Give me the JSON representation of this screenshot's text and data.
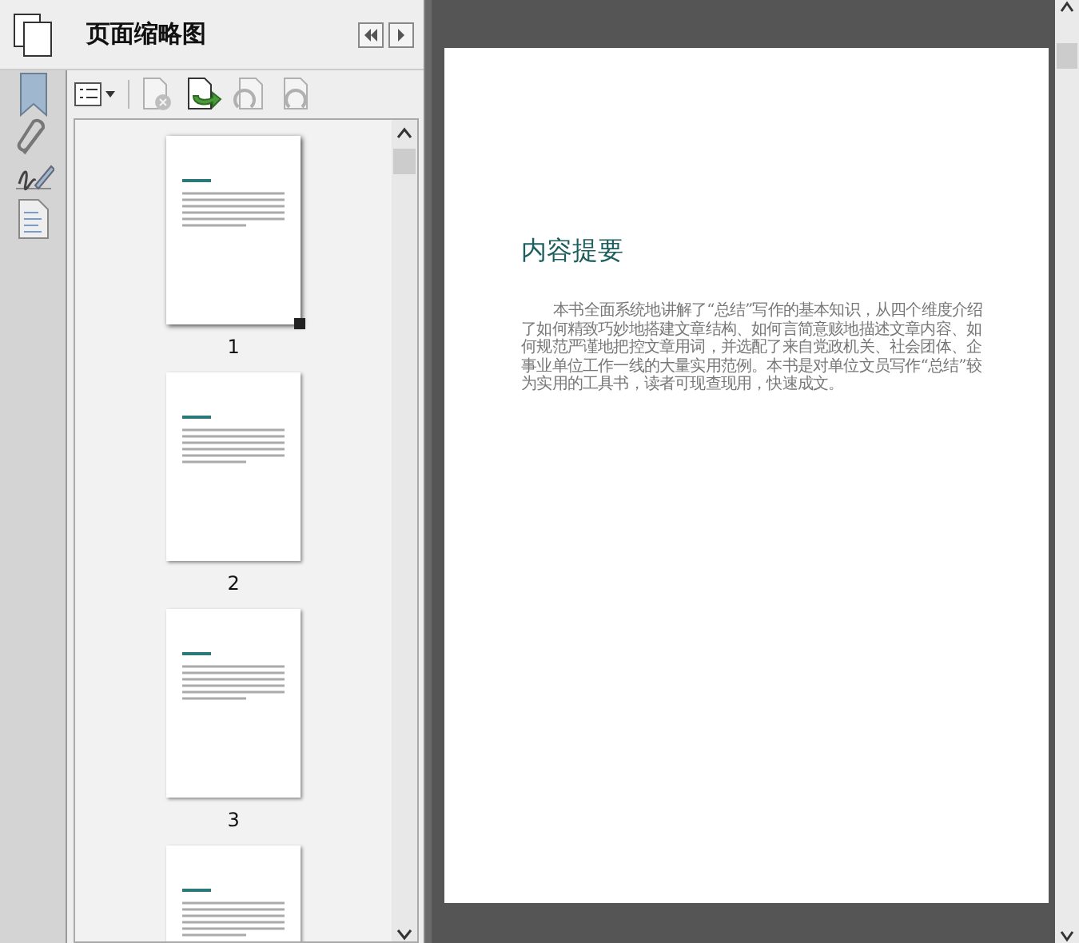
{
  "panel": {
    "title": "页面缩略图"
  },
  "toolbar": [
    {
      "kind": "options",
      "disabled": false
    },
    {
      "kind": "delete",
      "disabled": true
    },
    {
      "kind": "insert",
      "disabled": false
    },
    {
      "kind": "undo",
      "disabled": true
    },
    {
      "kind": "redo",
      "disabled": true
    }
  ],
  "thumbnails": [
    {
      "page": "1",
      "selected": true
    },
    {
      "page": "2",
      "selected": false
    },
    {
      "page": "3",
      "selected": false
    },
    {
      "selected": false
    }
  ],
  "document": {
    "heading": "内容提要",
    "paragraph": "本书全面系统地讲解了“总结”写作的基本知识，从四个维度介绍了如何精致巧妙地搭建文章结构、如何言简意赅地描述文章内容、如何规范严谨地把控文章用词，并选配了来自党政机关、社会团体、企事业单位工作一线的大量实用范例。本书是对单位文员写作“总结”较为实用的工具书，读者可现查现用，快速成文。"
  }
}
